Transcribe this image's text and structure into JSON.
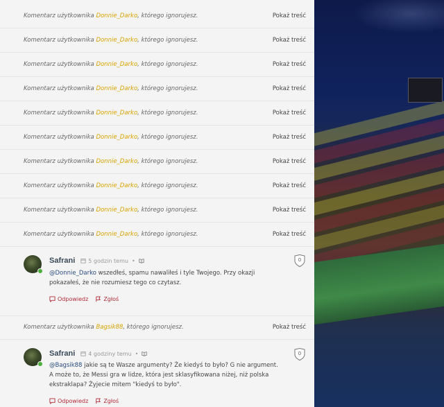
{
  "ignored_comments": {
    "prefix": "Komentarz użytkownika",
    "suffix": ", którego ignorujesz.",
    "show_label": "Pokaż treść",
    "users_top": [
      "Donnie_Darko",
      "Donnie_Darko",
      "Donnie_Darko",
      "Donnie_Darko",
      "Donnie_Darko",
      "Donnie_Darko",
      "Donnie_Darko",
      "Donnie_Darko",
      "Donnie_Darko",
      "Donnie_Darko"
    ],
    "user_mid": "Bagsik88"
  },
  "comments": [
    {
      "author": "Safrani",
      "time": "5 godzin temu",
      "mention": "@Donnie_Darko",
      "text": " wszedłeś, spamu nawaliłeś i tyle Twojego. Przy okazji pokazałeś, że nie rozumiesz tego co czytasz.",
      "score": "0",
      "reply_label": "Odpowiedz",
      "report_label": "Zgłoś"
    },
    {
      "author": "Safrani",
      "time": "4 godziny temu",
      "mention": "@Bagsik88",
      "text": " jakie są te Wasze argumenty? Że kiedyś to było? G nie argument. A może to, że Messi gra w lidze, która jest sklasyfikowana niżej, niż polska ekstraklapa? Żyjecie mitem \"kiedyś to było\".",
      "score": "0",
      "reply_label": "Odpowiedz",
      "report_label": "Zgłoś"
    }
  ],
  "colors": {
    "username_ignored": "#d9a300",
    "action_red": "#b02a35",
    "mention_blue": "#2a4c7e",
    "online_green": "#4caf3a"
  },
  "icons": [
    "calendar-icon",
    "book-icon",
    "comment-icon",
    "flag-icon",
    "shield-score-icon"
  ]
}
